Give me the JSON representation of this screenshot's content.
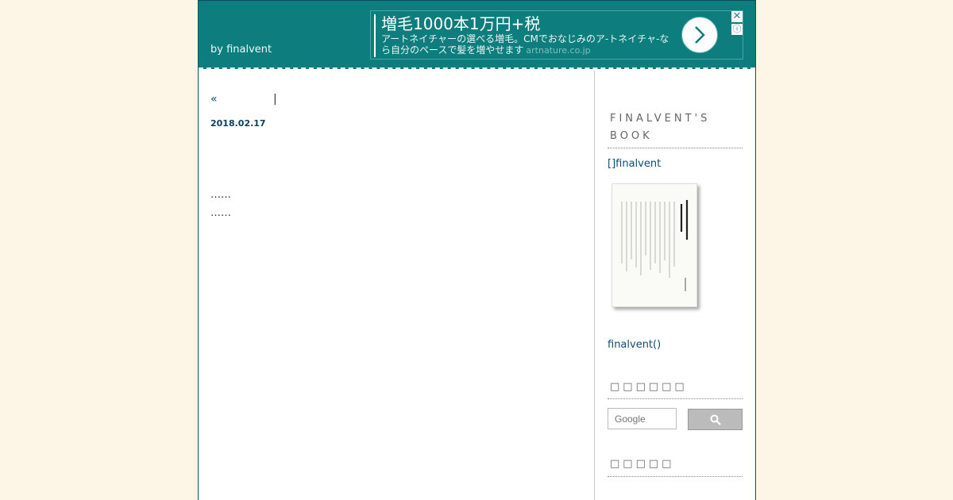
{
  "header": {
    "byline": "by finalvent"
  },
  "ad": {
    "title": "増毛1000本1万円+税",
    "description": "アートネイチャーの選べる増毛。CMでおなじみのア-トネイチャ-なら自分のペースで髪を増やせます",
    "domain": "artnature.co.jp",
    "close_glyph": "✕",
    "info_glyph": "ⓘ"
  },
  "main": {
    "nav_prev": "«",
    "nav_sep": "|",
    "date": "2018.02.17",
    "body_lines": [
      "……",
      "……"
    ]
  },
  "sidebar": {
    "book_heading": "FINALVENT'S BOOK",
    "book_link": "[]finalvent",
    "author_link": "finalvent()",
    "search_heading": "□□□□□□",
    "search_placeholder": "Google",
    "recent_heading": "□□□□□"
  },
  "colors": {
    "header_bg": "#0e7d7d",
    "page_bg": "#fdf6e6",
    "link": "#0b4d7a"
  }
}
